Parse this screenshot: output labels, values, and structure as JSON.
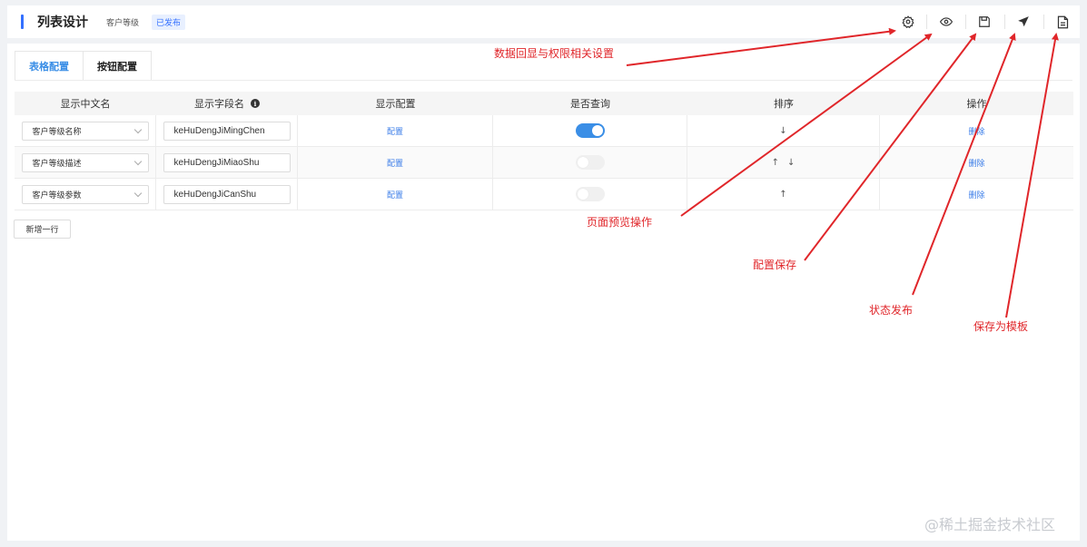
{
  "header": {
    "title": "列表设计",
    "subtitle": "客户等级",
    "status": "已发布",
    "tools": [
      "gear-icon",
      "eye-icon",
      "save-icon",
      "send-icon",
      "document-icon"
    ]
  },
  "tabs": [
    {
      "label": "表格配置",
      "active": true
    },
    {
      "label": "按钮配置",
      "active": false
    }
  ],
  "table": {
    "columns": [
      "显示中文名",
      "显示字段名",
      "显示配置",
      "是否查询",
      "排序",
      "操作"
    ],
    "rows": [
      {
        "cn_name": "客户等级名称",
        "field": "keHuDengJiMingChen",
        "config": "配置",
        "query": true,
        "sort": "↓",
        "action": "删除"
      },
      {
        "cn_name": "客户等级描述",
        "field": "keHuDengJiMiaoShu",
        "config": "配置",
        "query": false,
        "sort_up": "↑",
        "sort_down": "↓",
        "action": "删除"
      },
      {
        "cn_name": "客户等级参数",
        "field": "keHuDengJiCanShu",
        "config": "配置",
        "query": false,
        "sort": "↑",
        "action": "删除"
      }
    ]
  },
  "add_row_label": "新增一行",
  "annotations": {
    "settings": "数据回显与权限相关设置",
    "preview": "页面预览操作",
    "save": "配置保存",
    "publish": "状态发布",
    "template": "保存为模板"
  },
  "watermark": "@稀土掘金技术社区",
  "colors": {
    "accent": "#3370ff",
    "link": "#3a7ce8",
    "annotation": "#e0262a"
  }
}
